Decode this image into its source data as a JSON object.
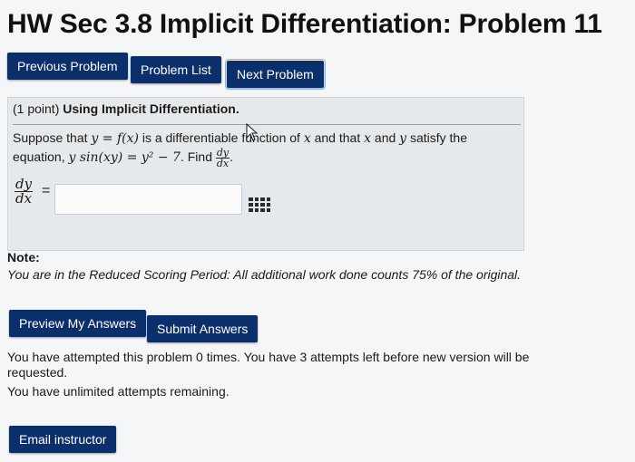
{
  "page": {
    "title": "HW Sec 3.8 Implicit Differentiation: Problem 11"
  },
  "nav": {
    "previous": "Previous Problem",
    "list": "Problem List",
    "next": "Next Problem"
  },
  "problem": {
    "points": "(1 point)",
    "heading": "Using Implicit Differentiation.",
    "line1_a": "Suppose that ",
    "line1_math1": "y = f(x)",
    "line1_b": " is a differentiable function of ",
    "line1_math2": "x",
    "line1_c": " and that ",
    "line1_math3": "x",
    "line1_d": " and ",
    "line1_math4": "y",
    "line1_e": " satisfy the",
    "line2_a": "equation, ",
    "line2_math": "y sin(xy) = y² − 7",
    "line2_b": ". Find ",
    "frac_num": "dy",
    "frac_den": "dx",
    "answer_lhs_num": "dy",
    "answer_lhs_den": "dx",
    "equals": "=",
    "answer_value": ""
  },
  "note": {
    "label": "Note:",
    "text": "You are in the Reduced Scoring Period: All additional work done counts 75% of the original."
  },
  "actions": {
    "preview": "Preview My Answers",
    "submit": "Submit Answers"
  },
  "status": {
    "line1": "You have attempted this problem 0 times. You have 3 attempts left before new version will be",
    "line2": "requested.",
    "line3": "You have unlimited attempts remaining."
  },
  "footer": {
    "email": "Email instructor"
  },
  "colors": {
    "button_bg": "#0b2f6a",
    "box_bg": "#e6e9ec"
  },
  "icons": {
    "equation_editor": "grid-icon",
    "cursor": "pointer-cursor-icon"
  }
}
